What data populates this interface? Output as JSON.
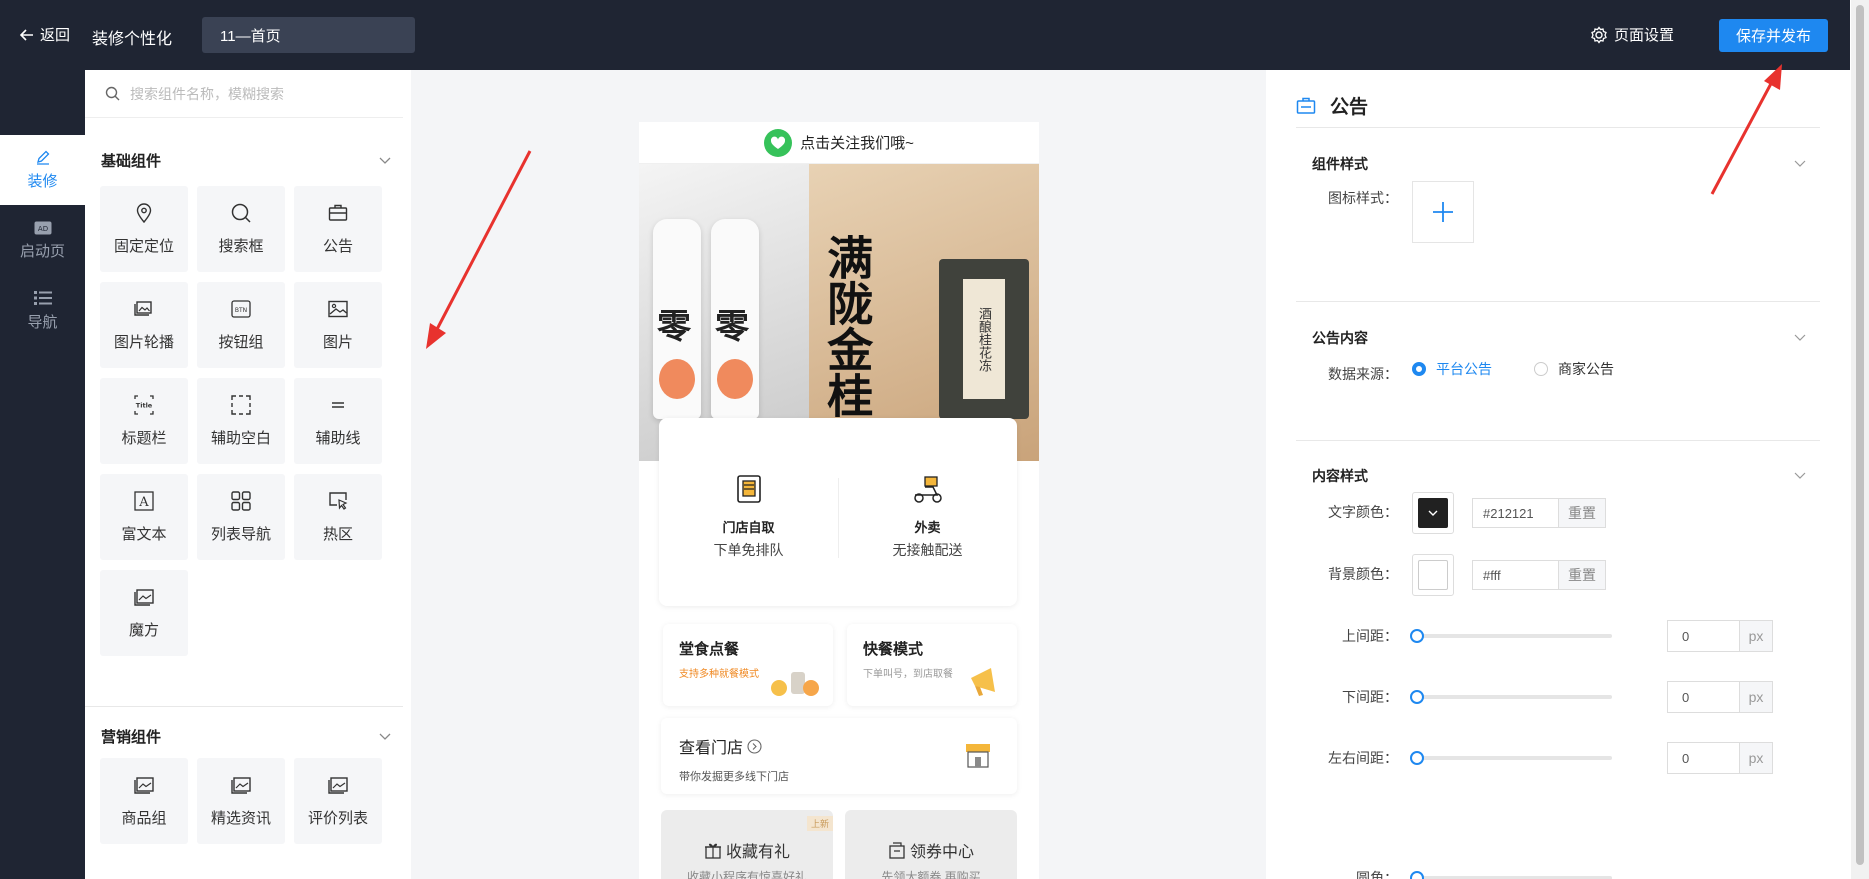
{
  "topbar": {
    "back_label": "返回",
    "title": "装修个性化",
    "page_name": "11—首页",
    "settings_label": "页面设置",
    "publish_label": "保存并发布"
  },
  "leftnav": {
    "items": [
      {
        "label": "装修",
        "icon": "edit-icon",
        "active": true
      },
      {
        "label": "启动页",
        "icon": "ad-icon",
        "active": false
      },
      {
        "label": "导航",
        "icon": "list-icon",
        "active": false
      }
    ]
  },
  "components": {
    "search_placeholder": "搜索组件名称，模糊搜索",
    "basic": {
      "title": "基础组件",
      "items": [
        {
          "label": "固定定位",
          "icon": "location-icon"
        },
        {
          "label": "搜索框",
          "icon": "search-icon"
        },
        {
          "label": "公告",
          "icon": "notice-icon"
        },
        {
          "label": "图片轮播",
          "icon": "carousel-icon"
        },
        {
          "label": "按钮组",
          "icon": "button-icon",
          "icon_text": "BTN"
        },
        {
          "label": "图片",
          "icon": "image-icon"
        },
        {
          "label": "标题栏",
          "icon": "title-icon",
          "icon_text": "Title"
        },
        {
          "label": "辅助空白",
          "icon": "blank-icon"
        },
        {
          "label": "辅助线",
          "icon": "line-icon"
        },
        {
          "label": "富文本",
          "icon": "richtext-icon",
          "icon_text": "A"
        },
        {
          "label": "列表导航",
          "icon": "grid-icon"
        },
        {
          "label": "热区",
          "icon": "hotspot-icon"
        },
        {
          "label": "魔方",
          "icon": "cube-icon"
        }
      ]
    },
    "marketing": {
      "title": "营销组件",
      "items": [
        {
          "label": "商品组",
          "icon": "goods-icon"
        },
        {
          "label": "精选资讯",
          "icon": "news-icon"
        },
        {
          "label": "评价列表",
          "icon": "review-icon"
        }
      ]
    }
  },
  "preview": {
    "follow_text": "点击关注我们哦~",
    "banner": {
      "bottle_char": "零",
      "headline": "满陇金桂",
      "scroll_text": "酒酿桂花冻"
    },
    "services": [
      {
        "title": "门店自取",
        "subtitle": "下单免排队",
        "icon": "store-pickup-icon"
      },
      {
        "title": "外卖",
        "subtitle": "无接触配送",
        "icon": "scooter-icon"
      }
    ],
    "modes": [
      {
        "title": "堂食点餐",
        "subtitle": "支持多种就餐模式",
        "subtitle_color": "#f08a24"
      },
      {
        "title": "快餐模式",
        "subtitle": "下单叫号，到店取餐",
        "subtitle_color": "#999999"
      }
    ],
    "store": {
      "title": "查看门店",
      "subtitle": "带你发掘更多线下门店"
    },
    "promos": [
      {
        "title": "收藏有礼",
        "subtitle": "收藏小程序有惊喜好礼",
        "tag": "上新"
      },
      {
        "title": "领券中心",
        "subtitle": "先领大额券 再购买"
      }
    ]
  },
  "props": {
    "title": "公告",
    "style_section": {
      "title": "组件样式",
      "icon_style_label": "图标样式："
    },
    "content_section": {
      "title": "公告内容",
      "source_label": "数据来源：",
      "options": [
        {
          "label": "平台公告",
          "selected": true
        },
        {
          "label": "商家公告",
          "selected": false
        }
      ]
    },
    "content_style": {
      "title": "内容样式",
      "text_color_label": "文字颜色：",
      "text_color": "#212121",
      "bg_color_label": "背景颜色：",
      "bg_color": "#fff",
      "reset_label": "重置",
      "unit": "px",
      "spacing": [
        {
          "label": "上间距：",
          "value": "0"
        },
        {
          "label": "下间距：",
          "value": "0"
        },
        {
          "label": "左右间距：",
          "value": "0"
        }
      ],
      "radius_label": "圆角："
    }
  },
  "colors": {
    "accent": "#1e88f0",
    "topbar": "#1f2533",
    "arrow": "#e8322e"
  }
}
